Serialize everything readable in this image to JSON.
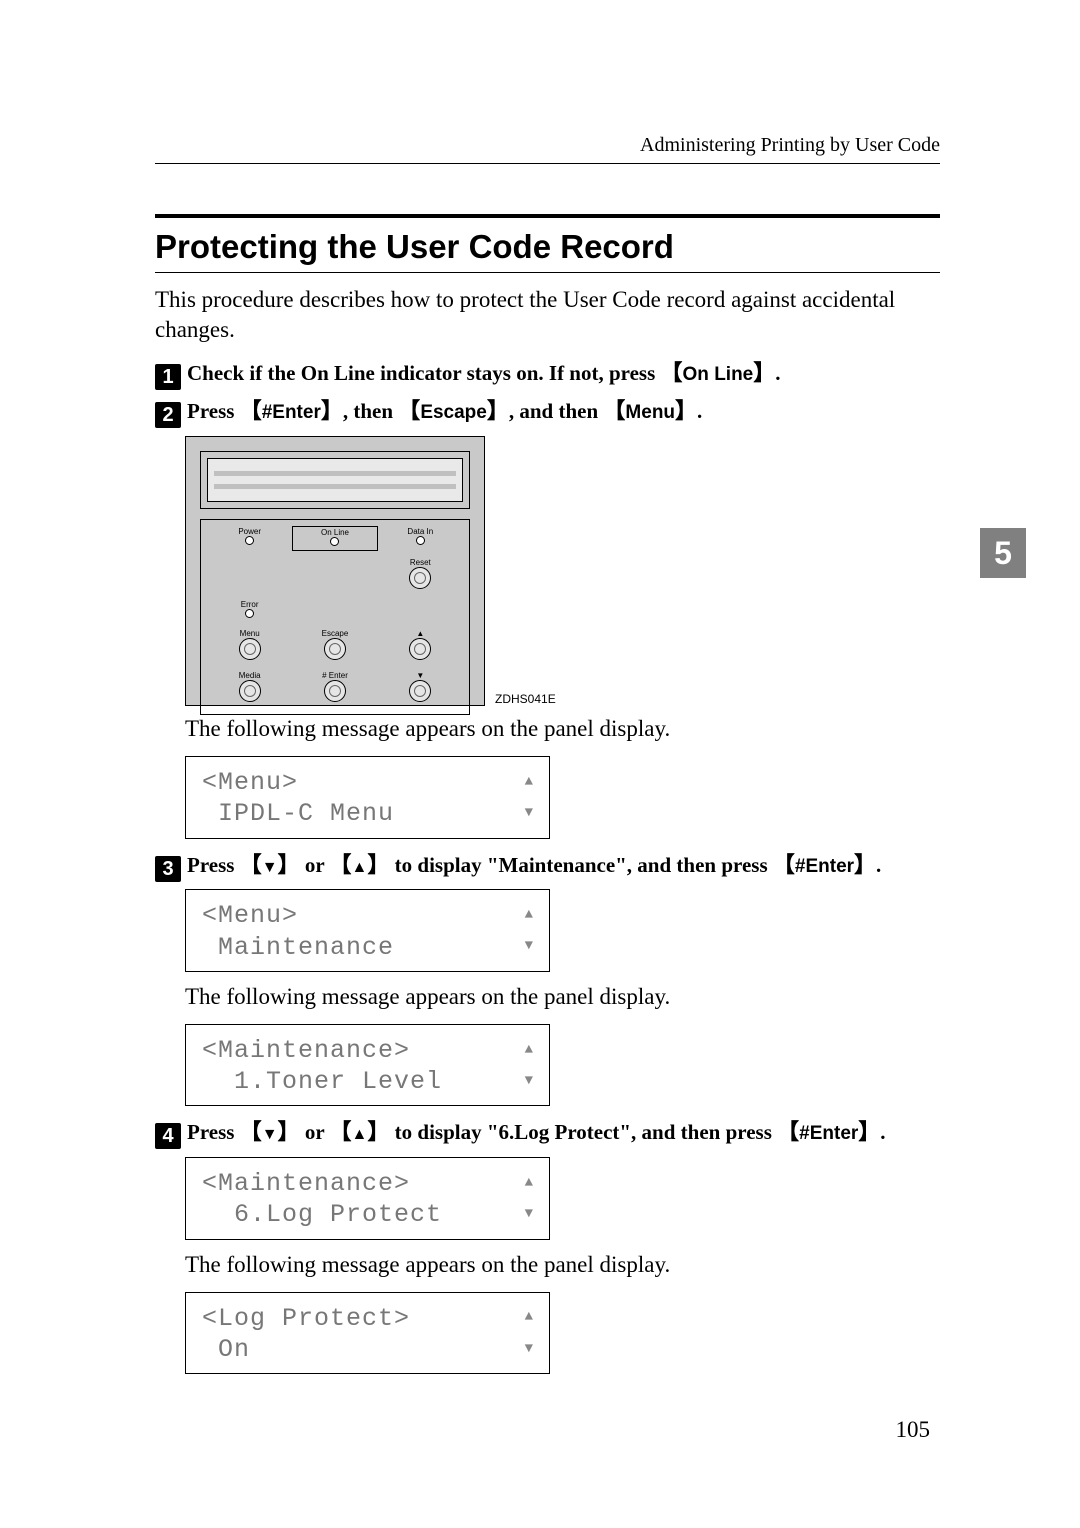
{
  "header": {
    "breadcrumb": "Administering Printing by User Code"
  },
  "section": {
    "title": "Protecting the User Code Record",
    "intro": "This procedure describes how to protect the User Code record against accidental changes."
  },
  "keys": {
    "online": "On Line",
    "enter": "#Enter",
    "escape": "Escape",
    "menu": "Menu",
    "down": "▼",
    "up": "▲"
  },
  "steps": {
    "s1": {
      "num": "1",
      "pre": "Check if the On Line indicator stays on. If not, press ",
      "post": "."
    },
    "s2": {
      "num": "2",
      "a": "Press ",
      "b": ", then ",
      "c": ", and then ",
      "d": "."
    },
    "s3": {
      "num": "3",
      "a": "Press ",
      "b": " or ",
      "c": " to display \"Maintenance\", and then press ",
      "d": "."
    },
    "s4": {
      "num": "4",
      "a": "Press ",
      "b": " or ",
      "c": " to display \"6.Log Protect\", and then press ",
      "d": "."
    }
  },
  "panel": {
    "labels": {
      "power": "Power",
      "online": "On Line",
      "datain": "Data In",
      "reset": "Reset",
      "error": "Error",
      "menu": "Menu",
      "escape": "Escape",
      "media": "Media",
      "enter": "# Enter"
    },
    "caption": "ZDHS041E"
  },
  "messages": {
    "appears": "The following message appears on the panel display."
  },
  "lcd": {
    "d1": {
      "l1": "<Menu>",
      "l2": " IPDL-C Menu"
    },
    "d2": {
      "l1": "<Menu>",
      "l2": " Maintenance"
    },
    "d3": {
      "l1": "<Maintenance>",
      "l2": "  1.Toner Level"
    },
    "d4": {
      "l1": "<Maintenance>",
      "l2": "  6.Log Protect"
    },
    "d5": {
      "l1": "<Log Protect>",
      "l2": " On"
    }
  },
  "scroll": {
    "up": "▲",
    "down": "▼"
  },
  "chapter": "5",
  "page": "105"
}
